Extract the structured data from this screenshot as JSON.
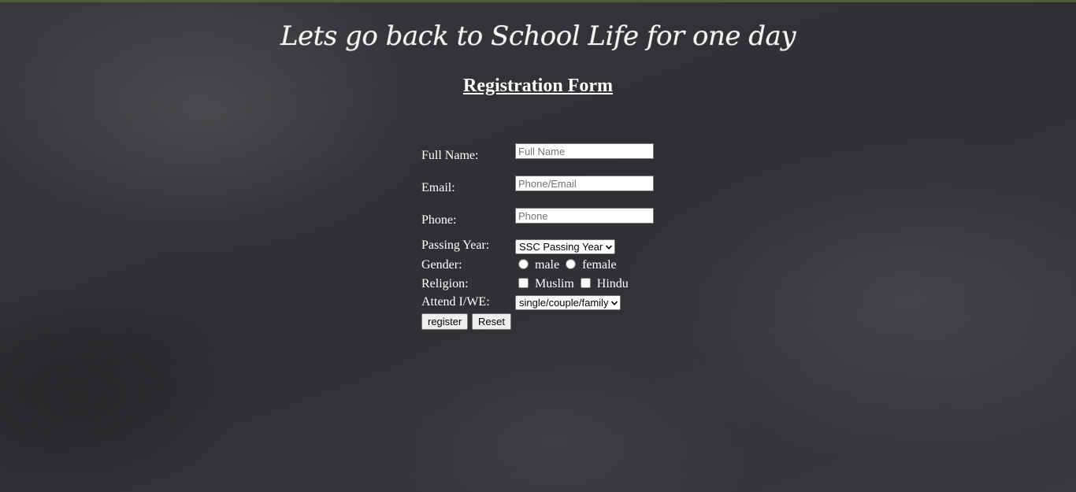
{
  "page": {
    "headline": "Lets go back to School Life for one day",
    "form_title": "Registration Form"
  },
  "form": {
    "full_name": {
      "label": "Full Name:",
      "placeholder": "Full Name",
      "value": ""
    },
    "email": {
      "label": "Email:",
      "placeholder": "Phone/Email",
      "value": ""
    },
    "phone": {
      "label": "Phone:",
      "placeholder": "Phone",
      "value": ""
    },
    "passing_year": {
      "label": "Passing Year:",
      "selected": "SSC Passing Year"
    },
    "gender": {
      "label": "Gender:",
      "options": [
        "male",
        "female"
      ]
    },
    "religion": {
      "label": "Religion:",
      "options": [
        "Muslim",
        "Hindu"
      ]
    },
    "attend": {
      "label": "Attend I/WE:",
      "selected": "single/couple/family"
    },
    "buttons": {
      "register": "register",
      "reset": "Reset"
    }
  },
  "colors": {
    "background": "#333236",
    "text": "#ffffff",
    "top_strip": "#4e5e3c"
  },
  "icons": [
    "chevron-down-icon"
  ]
}
